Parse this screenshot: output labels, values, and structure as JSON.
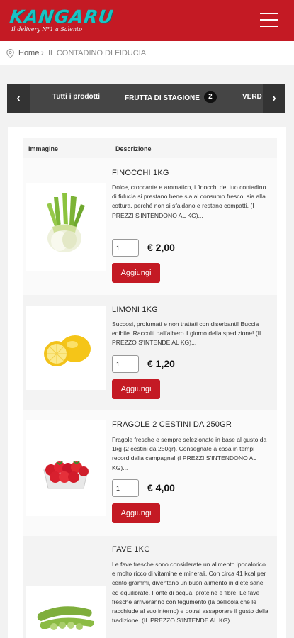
{
  "header": {
    "logo_text": "KANGARU",
    "logo_tagline": "Il delivery N°1 a Salento",
    "menu_icon": "hamburger-menu-icon",
    "brand_color": "#c41a24",
    "logo_color": "#19c4c4"
  },
  "breadcrumb": {
    "icon": "location-pin-icon",
    "home": "Home",
    "separator": "›",
    "current": "IL CONTADINO DI FIDUCIA"
  },
  "categories": {
    "prev_icon": "chevron-left-icon",
    "next_icon": "chevron-right-icon",
    "items": [
      {
        "label": "Tutti i prodotti"
      },
      {
        "label": "FRUTTA DI STAGIONE",
        "badge": "2"
      },
      {
        "label": "VERD"
      }
    ]
  },
  "table": {
    "columns": [
      "Immagine",
      "Descrizione"
    ]
  },
  "products": [
    {
      "image": "fennel-image",
      "title": "FINOCCHI 1KG",
      "description": "Dolce, croccante e aromatico, i finocchi del tuo contadino di fiducia si prestano bene sia al consumo fresco, sia alla cottura, perché non si sfaldano e restano compatti. (I PREZZI S'INTENDONO AL KG)...",
      "quantity": "1",
      "price": "€ 2,00",
      "button": "Aggiungi"
    },
    {
      "image": "lemon-image",
      "title": "LIMONI 1KG",
      "description": "Succosi, profumati e non trattati con diserbanti! Buccia edibile. Raccolti dall'albero il giorno della spedizione! (IL PREZZO S'INTENDE AL KG)...",
      "quantity": "1",
      "price": "€ 1,20",
      "button": "Aggiungi"
    },
    {
      "image": "strawberries-image",
      "title": "FRAGOLE 2 CESTINI DA 250GR",
      "description": "Fragole fresche e sempre selezionate in base al gusto da 1kg (2 cestini da 250gr). Consegnate a casa in tempi record dalla campagna! (I PREZZI S'INTENDONO AL KG)...",
      "quantity": "1",
      "price": "€ 4,00",
      "button": "Aggiungi"
    },
    {
      "image": "fava-beans-image",
      "title": "FAVE 1KG",
      "description": "Le fave fresche sono considerate un alimento ipocalorico e molto ricco di vitamine e minerali. Con circa 41 kcal per cento grammi, diventano un buon alimento in diete sane ed equilibrate. Fonte di acqua, proteine e fibre. Le fave fresche arriveranno con tegumento (la pellicola che le racchiude al suo interno) e potrai assaporare il gusto della tradizione. (IL PREZZO S'INTENDE AL KG)..."
    }
  ]
}
